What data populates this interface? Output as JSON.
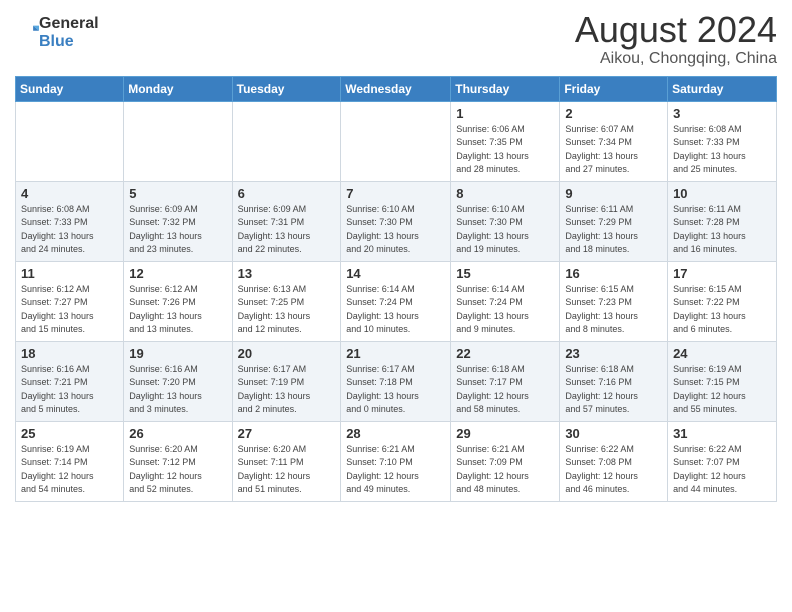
{
  "header": {
    "logo_line1": "General",
    "logo_line2": "Blue",
    "month_year": "August 2024",
    "location": "Aikou, Chongqing, China"
  },
  "days_of_week": [
    "Sunday",
    "Monday",
    "Tuesday",
    "Wednesday",
    "Thursday",
    "Friday",
    "Saturday"
  ],
  "weeks": [
    [
      {
        "day": "",
        "info": ""
      },
      {
        "day": "",
        "info": ""
      },
      {
        "day": "",
        "info": ""
      },
      {
        "day": "",
        "info": ""
      },
      {
        "day": "1",
        "info": "Sunrise: 6:06 AM\nSunset: 7:35 PM\nDaylight: 13 hours\nand 28 minutes."
      },
      {
        "day": "2",
        "info": "Sunrise: 6:07 AM\nSunset: 7:34 PM\nDaylight: 13 hours\nand 27 minutes."
      },
      {
        "day": "3",
        "info": "Sunrise: 6:08 AM\nSunset: 7:33 PM\nDaylight: 13 hours\nand 25 minutes."
      }
    ],
    [
      {
        "day": "4",
        "info": "Sunrise: 6:08 AM\nSunset: 7:33 PM\nDaylight: 13 hours\nand 24 minutes."
      },
      {
        "day": "5",
        "info": "Sunrise: 6:09 AM\nSunset: 7:32 PM\nDaylight: 13 hours\nand 23 minutes."
      },
      {
        "day": "6",
        "info": "Sunrise: 6:09 AM\nSunset: 7:31 PM\nDaylight: 13 hours\nand 22 minutes."
      },
      {
        "day": "7",
        "info": "Sunrise: 6:10 AM\nSunset: 7:30 PM\nDaylight: 13 hours\nand 20 minutes."
      },
      {
        "day": "8",
        "info": "Sunrise: 6:10 AM\nSunset: 7:30 PM\nDaylight: 13 hours\nand 19 minutes."
      },
      {
        "day": "9",
        "info": "Sunrise: 6:11 AM\nSunset: 7:29 PM\nDaylight: 13 hours\nand 18 minutes."
      },
      {
        "day": "10",
        "info": "Sunrise: 6:11 AM\nSunset: 7:28 PM\nDaylight: 13 hours\nand 16 minutes."
      }
    ],
    [
      {
        "day": "11",
        "info": "Sunrise: 6:12 AM\nSunset: 7:27 PM\nDaylight: 13 hours\nand 15 minutes."
      },
      {
        "day": "12",
        "info": "Sunrise: 6:12 AM\nSunset: 7:26 PM\nDaylight: 13 hours\nand 13 minutes."
      },
      {
        "day": "13",
        "info": "Sunrise: 6:13 AM\nSunset: 7:25 PM\nDaylight: 13 hours\nand 12 minutes."
      },
      {
        "day": "14",
        "info": "Sunrise: 6:14 AM\nSunset: 7:24 PM\nDaylight: 13 hours\nand 10 minutes."
      },
      {
        "day": "15",
        "info": "Sunrise: 6:14 AM\nSunset: 7:24 PM\nDaylight: 13 hours\nand 9 minutes."
      },
      {
        "day": "16",
        "info": "Sunrise: 6:15 AM\nSunset: 7:23 PM\nDaylight: 13 hours\nand 8 minutes."
      },
      {
        "day": "17",
        "info": "Sunrise: 6:15 AM\nSunset: 7:22 PM\nDaylight: 13 hours\nand 6 minutes."
      }
    ],
    [
      {
        "day": "18",
        "info": "Sunrise: 6:16 AM\nSunset: 7:21 PM\nDaylight: 13 hours\nand 5 minutes."
      },
      {
        "day": "19",
        "info": "Sunrise: 6:16 AM\nSunset: 7:20 PM\nDaylight: 13 hours\nand 3 minutes."
      },
      {
        "day": "20",
        "info": "Sunrise: 6:17 AM\nSunset: 7:19 PM\nDaylight: 13 hours\nand 2 minutes."
      },
      {
        "day": "21",
        "info": "Sunrise: 6:17 AM\nSunset: 7:18 PM\nDaylight: 13 hours\nand 0 minutes."
      },
      {
        "day": "22",
        "info": "Sunrise: 6:18 AM\nSunset: 7:17 PM\nDaylight: 12 hours\nand 58 minutes."
      },
      {
        "day": "23",
        "info": "Sunrise: 6:18 AM\nSunset: 7:16 PM\nDaylight: 12 hours\nand 57 minutes."
      },
      {
        "day": "24",
        "info": "Sunrise: 6:19 AM\nSunset: 7:15 PM\nDaylight: 12 hours\nand 55 minutes."
      }
    ],
    [
      {
        "day": "25",
        "info": "Sunrise: 6:19 AM\nSunset: 7:14 PM\nDaylight: 12 hours\nand 54 minutes."
      },
      {
        "day": "26",
        "info": "Sunrise: 6:20 AM\nSunset: 7:12 PM\nDaylight: 12 hours\nand 52 minutes."
      },
      {
        "day": "27",
        "info": "Sunrise: 6:20 AM\nSunset: 7:11 PM\nDaylight: 12 hours\nand 51 minutes."
      },
      {
        "day": "28",
        "info": "Sunrise: 6:21 AM\nSunset: 7:10 PM\nDaylight: 12 hours\nand 49 minutes."
      },
      {
        "day": "29",
        "info": "Sunrise: 6:21 AM\nSunset: 7:09 PM\nDaylight: 12 hours\nand 48 minutes."
      },
      {
        "day": "30",
        "info": "Sunrise: 6:22 AM\nSunset: 7:08 PM\nDaylight: 12 hours\nand 46 minutes."
      },
      {
        "day": "31",
        "info": "Sunrise: 6:22 AM\nSunset: 7:07 PM\nDaylight: 12 hours\nand 44 minutes."
      }
    ]
  ]
}
